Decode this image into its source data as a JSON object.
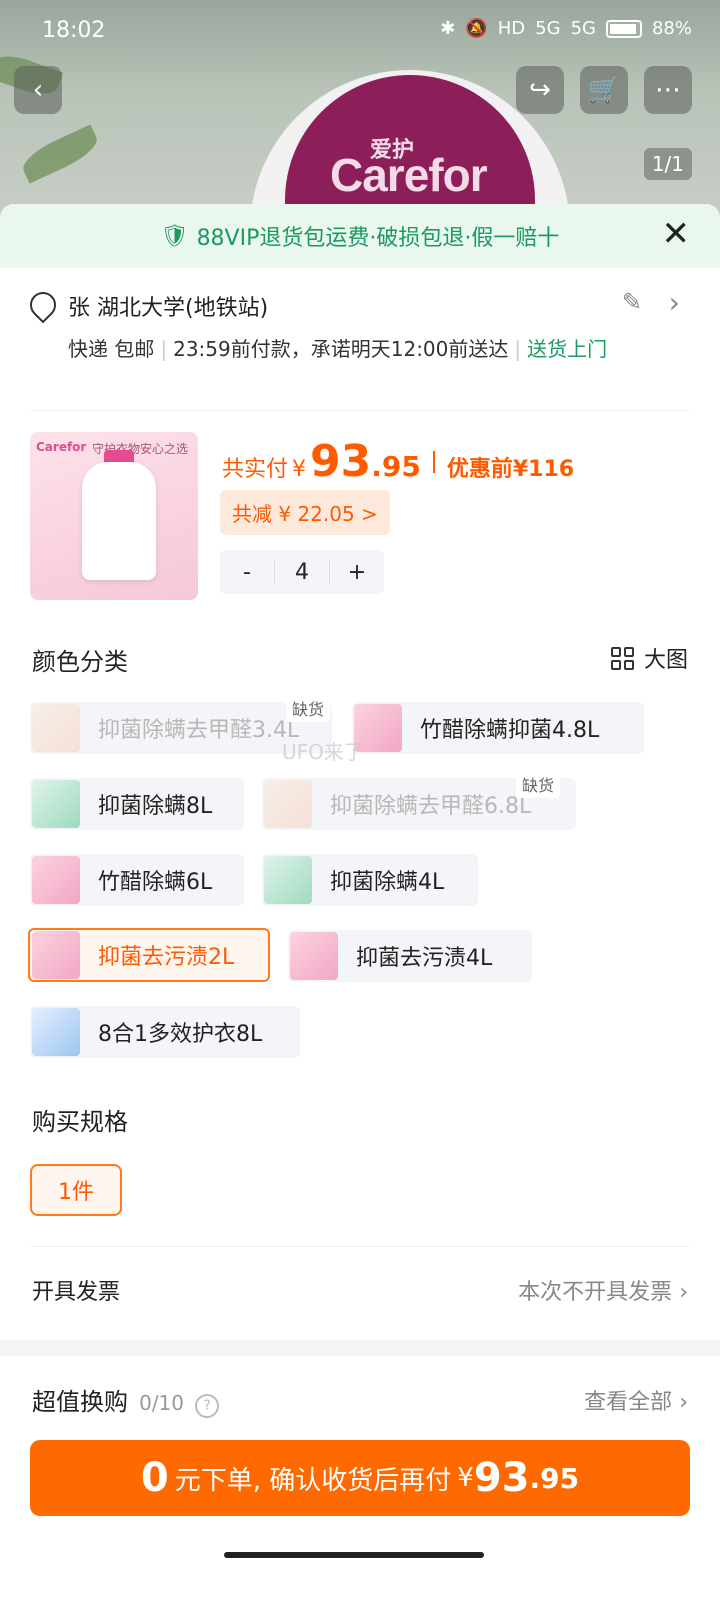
{
  "status_bar": {
    "time": "18:02",
    "battery": "88%",
    "net1": "5G",
    "net2": "5G",
    "hd": "HD"
  },
  "header": {
    "brand_cn": "爱护",
    "brand_en": "Carefor",
    "pager": "1/1"
  },
  "banner": {
    "text": "88VIP退货包运费·破损包退·假一赔十"
  },
  "address": {
    "name": "张 湖北大学(地铁站)",
    "delivery": "快递 包邮",
    "promise": "23:59前付款，承诺明天12:00前送达",
    "door": "送货上门"
  },
  "product": {
    "thumb_tag": "Carefor",
    "thumb_slogan": "守护衣物安心之选",
    "pay_label": "共实付",
    "yen": "¥",
    "price_int": "93",
    "price_dec": ".95",
    "orig_label": "优惠前",
    "orig_price": "¥116",
    "discount": "共减 ¥ 22.05 >",
    "qty_minus": "-",
    "qty": "4",
    "qty_plus": "+"
  },
  "colors": {
    "title": "颜色分类",
    "big_view": "大图",
    "oos": "缺货",
    "watermark": "UFO来了",
    "options": [
      {
        "label": "抑菌除螨去甲醛3.4L",
        "state": "disabled"
      },
      {
        "label": "竹醋除螨抑菌4.8L",
        "state": "normal"
      },
      {
        "label": "抑菌除螨8L",
        "state": "normal"
      },
      {
        "label": "抑菌除螨去甲醛6.8L",
        "state": "disabled"
      },
      {
        "label": "竹醋除螨6L",
        "state": "normal"
      },
      {
        "label": "抑菌除螨4L",
        "state": "normal"
      },
      {
        "label": "抑菌去污渍2L",
        "state": "selected"
      },
      {
        "label": "抑菌去污渍4L",
        "state": "normal"
      },
      {
        "label": "8合1多效护衣8L",
        "state": "normal"
      }
    ]
  },
  "spec": {
    "title": "购买规格",
    "option": "1件"
  },
  "invoice": {
    "label": "开具发票",
    "value": "本次不开具发票"
  },
  "swap": {
    "title": "超值换购",
    "count": "0/10",
    "help": "?",
    "view_all": "查看全部"
  },
  "cta": {
    "big": "0",
    "mid": "元下单, 确认收货后再付",
    "yen": "¥",
    "int": "93",
    "dec": ".95"
  }
}
